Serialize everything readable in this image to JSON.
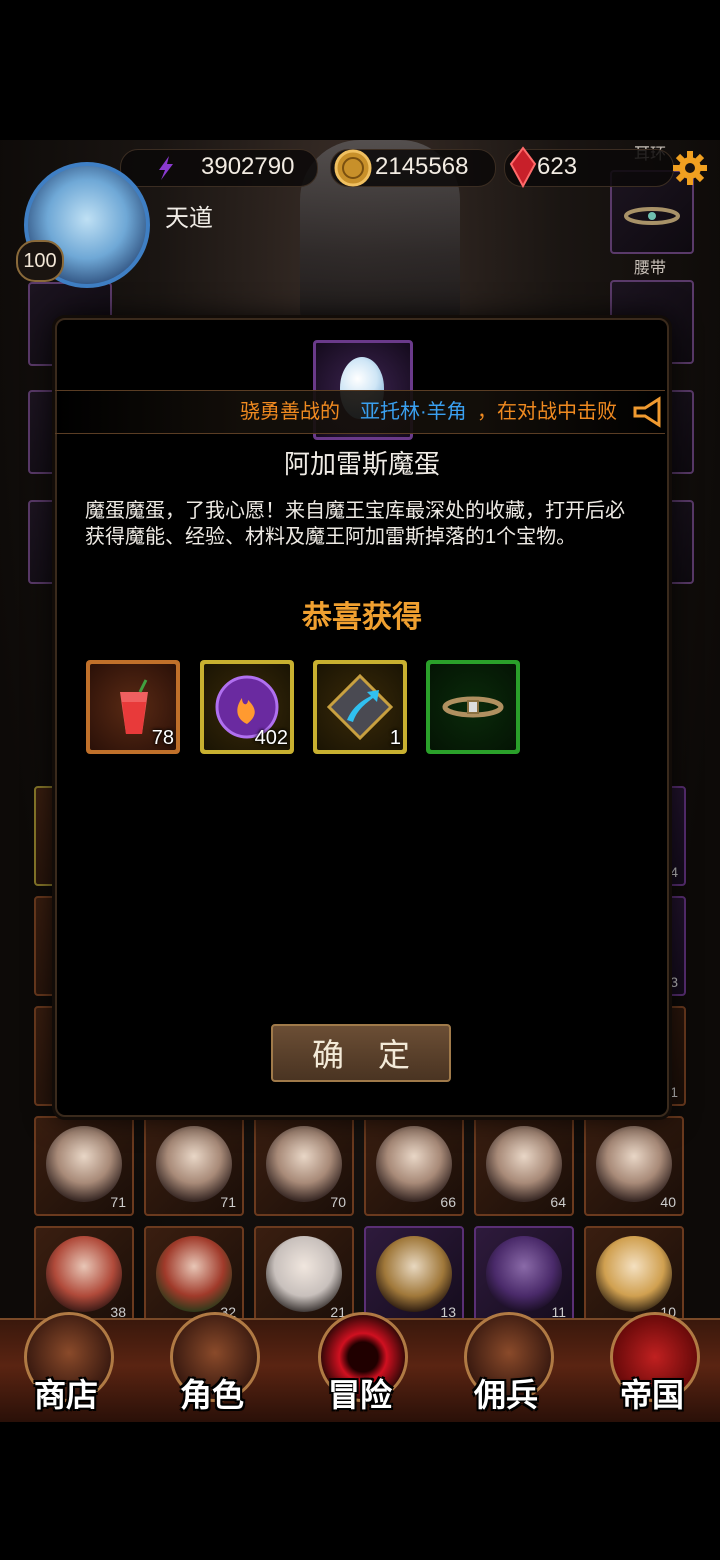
{
  "hud": {
    "power": "3902790",
    "gold": "2145568",
    "gems": "623",
    "player_name": "天道",
    "player_level": "100"
  },
  "equipment": {
    "earring_label": "耳环",
    "belt_label": "腰带"
  },
  "marquee": {
    "prefix": "骁勇善战的",
    "name": "亚托林·羊角",
    "suffix": "，在对战中击败"
  },
  "modal": {
    "item_name": "阿加雷斯魔蛋",
    "item_description": "魔蛋魔蛋，了我心愿！来自魔王宝库最深处的收藏，打开后必获得魔能、经验、材料及魔王阿加雷斯掉落的1个宝物。",
    "congrats_title": "恭喜获得",
    "confirm_label": "确定",
    "rewards": [
      {
        "name": "drink",
        "qty": "78"
      },
      {
        "name": "magic-orb",
        "qty": "402"
      },
      {
        "name": "upgrade-stone",
        "qty": "1"
      },
      {
        "name": "belt",
        "qty": ""
      }
    ]
  },
  "heroes": {
    "row1": [
      "71",
      "71",
      "70",
      "66",
      "64",
      "40"
    ],
    "row2": [
      "38",
      "32",
      "21",
      "13",
      "11",
      "10"
    ]
  },
  "side_levels": [
    "4",
    "3",
    "1"
  ],
  "nav": {
    "shop": "商店",
    "character": "角色",
    "adventure": "冒险",
    "mercenary": "佣兵",
    "empire": "帝国"
  },
  "colors": {
    "congrats": "#f0a030",
    "marquee_orange": "#f08a20",
    "marquee_name": "#3aa0f0",
    "reward_orange_border": "#c0702a",
    "reward_yellow_border": "#c8b030",
    "reward_green_border": "#2aa02a"
  }
}
